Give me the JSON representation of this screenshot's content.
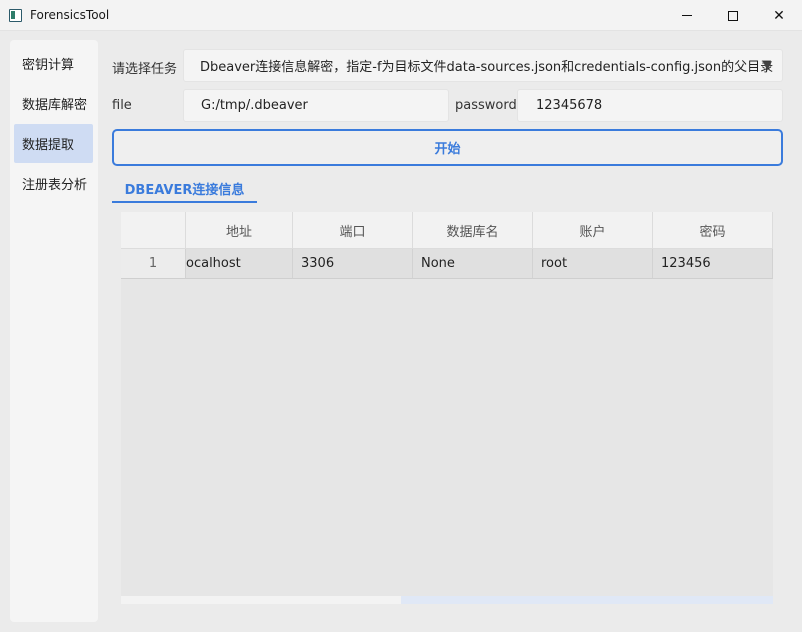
{
  "window": {
    "title": "ForensicsTool",
    "minimize_icon": "minimize-icon",
    "maximize_icon": "maximize-icon",
    "close_label": "✕"
  },
  "sidebar": {
    "items": [
      {
        "label": "密钥计算",
        "active": false
      },
      {
        "label": "数据库解密",
        "active": false
      },
      {
        "label": "数据提取",
        "active": true
      },
      {
        "label": "注册表分析",
        "active": false
      }
    ]
  },
  "form": {
    "task_label": "请选择任务",
    "task_value": "Dbeaver连接信息解密，指定-f为目标文件data-sources.json和credentials-config.json的父目录",
    "file_label": "file",
    "file_value": "G:/tmp/.dbeaver",
    "password_label": "password",
    "password_value": "12345678",
    "start_label": "开始"
  },
  "tabs": [
    {
      "label": "DBEAVER连接信息",
      "active": true
    }
  ],
  "table": {
    "columns": [
      "地址",
      "端口",
      "数据库名",
      "账户",
      "密码"
    ],
    "rows": [
      {
        "num": "1",
        "cells": [
          "ocalhost",
          "3306",
          "None",
          "root",
          "123456"
        ]
      }
    ]
  },
  "colors": {
    "accent": "#3a7bdc",
    "sidebar_active": "#cfdcf3"
  }
}
